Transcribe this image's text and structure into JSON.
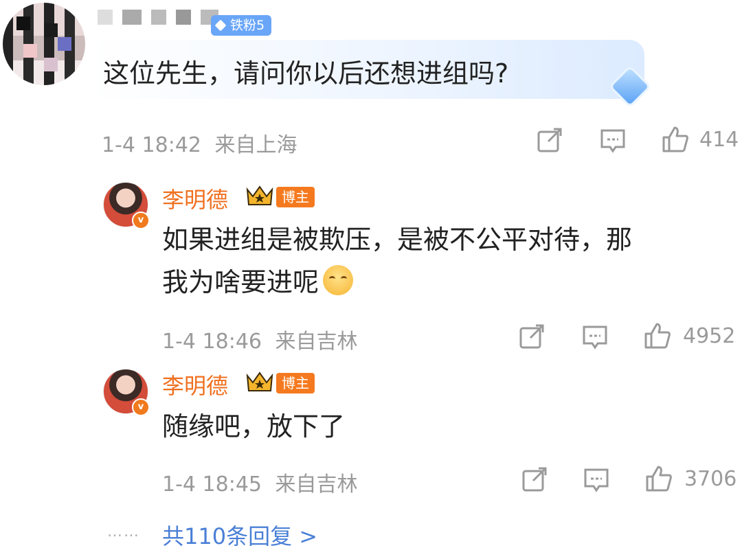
{
  "top_comment": {
    "badge": "铁粉5",
    "text": "这位先生，请问你以后还想进组吗?",
    "time": "1-4 18:42",
    "location": "来自上海",
    "likes": "414",
    "icons": [
      "share-icon",
      "comment-icon",
      "like-icon"
    ]
  },
  "replies": [
    {
      "name": "李明德",
      "badge": "博主",
      "verified": "v",
      "text_line1": "如果进组是被欺压，是被不公平对待，那",
      "text_line2": "我为啥要进呢",
      "time": "1-4 18:46",
      "location": "来自吉林",
      "likes": "4952"
    },
    {
      "name": "李明德",
      "badge": "博主",
      "verified": "v",
      "text_line1": "随缘吧，放下了",
      "time": "1-4 18:45",
      "location": "来自吉林",
      "likes": "3706"
    }
  ],
  "more": {
    "dots": "……",
    "label": "共110条回复 >"
  },
  "colors": {
    "name_orange": "#f07020",
    "badge_orange": "#f57a1f",
    "fan_badge_blue": "#6aa6f8",
    "link_blue": "#4a7fd6",
    "meta_gray": "#9a9a9a"
  }
}
